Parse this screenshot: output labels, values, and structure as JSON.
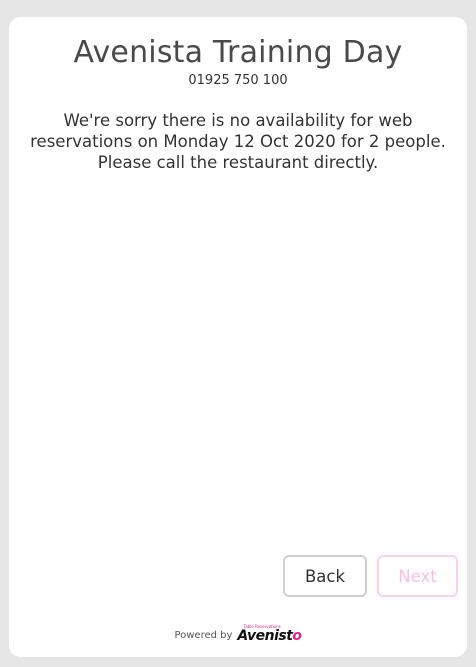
{
  "restaurant": {
    "name": "Avenista Training Day",
    "phone": "01925 750 100"
  },
  "message": "We're sorry there is no availability for web reservations on Monday 12 Oct 2020 for 2 people. Please call the restaurant directly.",
  "buttons": {
    "back_label": "Back",
    "next_label": "Next"
  },
  "footer": {
    "powered_by": "Powered by",
    "logo_tagline": "Table Reservations",
    "logo_text": "Avenist",
    "logo_o": "o"
  },
  "colors": {
    "background": "#e6e6e6",
    "accent": "#e0218a",
    "next_disabled_text": "#f9bde3",
    "next_disabled_border": "#fbd0ec"
  }
}
